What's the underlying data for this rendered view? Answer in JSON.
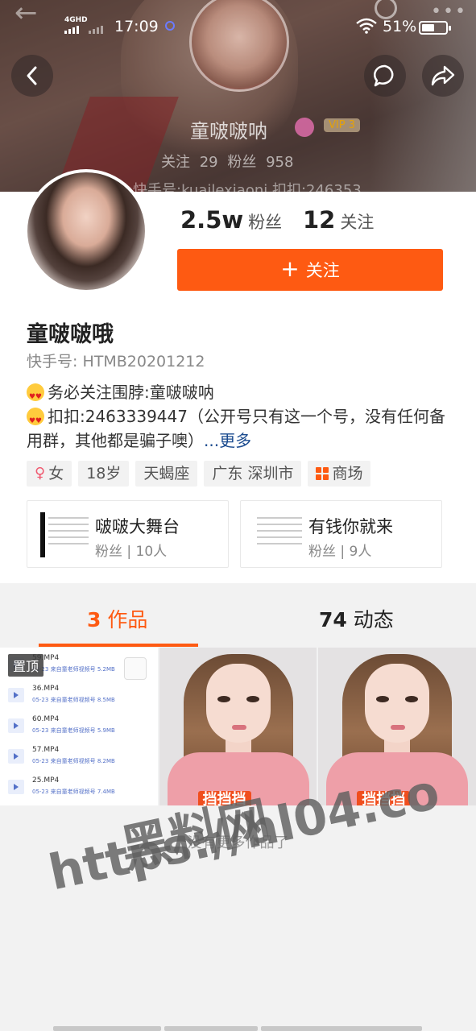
{
  "status_bar": {
    "network": "4GHD",
    "time": "17:09",
    "battery": "51%"
  },
  "header": {
    "banner_name": "童啵啵呐",
    "vip_label": "VIP 3",
    "banner_stats": "关注 29 粉丝 958",
    "banner_id": "快手号:kuailexiaoni 扣扣:246353"
  },
  "profile": {
    "fans_count": "2.5w",
    "fans_label": "粉丝",
    "following_count": "12",
    "following_label": "关注",
    "follow_button": "关注",
    "name": "童啵啵哦",
    "kuaishou_id": "快手号: HTMB20201212",
    "bio_line1": "务必关注围脖:童啵啵呐",
    "bio_line2": "扣扣:2463339447（公开号只有这一个号，没有任何备用群，其他都是骗子噢）",
    "bio_more": "...更多",
    "tags": [
      "女",
      "18岁",
      "天蝎座",
      "广东 深圳市",
      "商场"
    ]
  },
  "groups": [
    {
      "name": "啵啵大舞台",
      "fans": "粉丝 | 10人"
    },
    {
      "name": "有钱你就来",
      "fans": "粉丝 | 9人"
    }
  ],
  "tabs": {
    "works_count": "3",
    "works_label": "作品",
    "dynamics_count": "74",
    "dynamics_label": "动态"
  },
  "grid": {
    "pinned_label": "置顶",
    "files": [
      {
        "name": "59.MP4",
        "meta_date": "05-23",
        "meta_src": "来自童老师视频号",
        "size": "5.2MB"
      },
      {
        "name": "36.MP4",
        "meta_date": "05-23",
        "meta_src": "来自童老师视频号",
        "size": "8.5MB"
      },
      {
        "name": "60.MP4",
        "meta_date": "05-23",
        "meta_src": "来自童老师视频号",
        "size": "5.9MB"
      },
      {
        "name": "57.MP4",
        "meta_date": "05-23",
        "meta_src": "来自童老师视频号",
        "size": "8.2MB"
      },
      {
        "name": "25.MP4",
        "meta_date": "05-23",
        "meta_src": "来自童老师视频号",
        "size": "7.4MB"
      }
    ],
    "sticker": "挡挡挡"
  },
  "footer": {
    "no_more": "没有更多作品了"
  },
  "watermark": {
    "line1": "黑料网",
    "line2": "https://hl04.co"
  },
  "colors": {
    "accent": "#fe5a12",
    "link": "#1b4b8f"
  }
}
